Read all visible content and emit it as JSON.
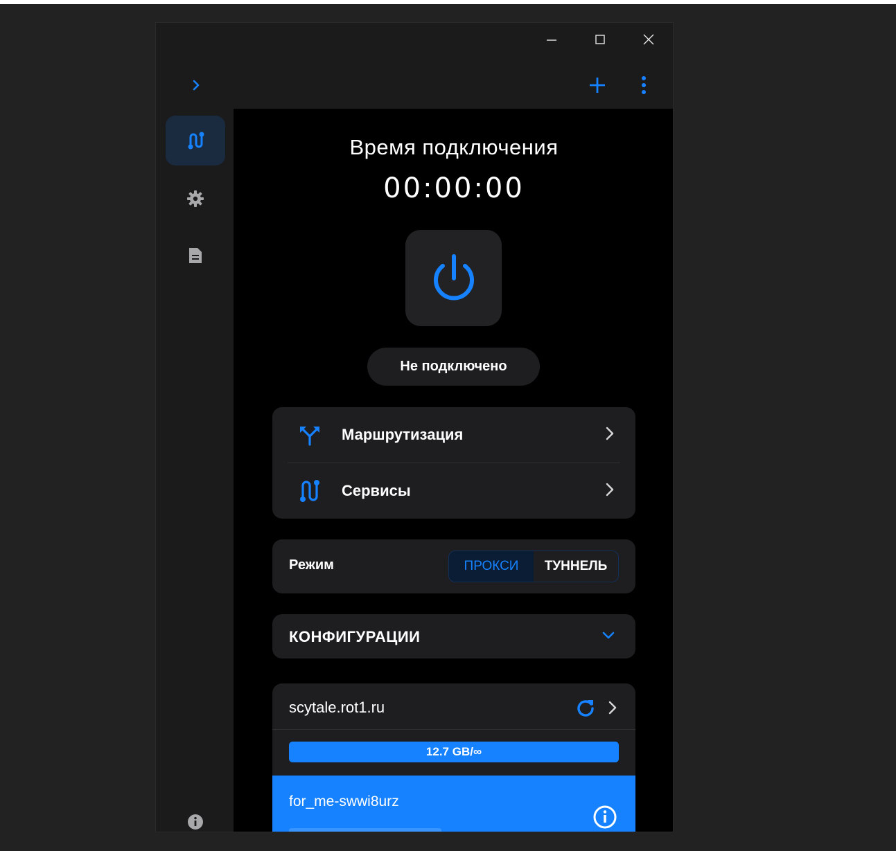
{
  "window": {
    "controls": {
      "minimize": "minimize-icon",
      "maximize": "maximize-icon",
      "close": "close-icon"
    }
  },
  "appbar": {
    "expand_icon": "chevron-right-icon",
    "add_icon": "plus-icon",
    "more_icon": "more-vertical-icon"
  },
  "rail": {
    "items": [
      {
        "icon": "routes-icon",
        "active": true
      },
      {
        "icon": "gear-icon",
        "active": false
      },
      {
        "icon": "document-icon",
        "active": false
      }
    ],
    "bottom_icon": "info-icon"
  },
  "connection": {
    "title": "Время подключения",
    "time": "00:00:00",
    "power_icon": "power-icon",
    "status": "Не подключено"
  },
  "routing": {
    "items": [
      {
        "label": "Маршрутизация",
        "icon": "split-route-icon"
      },
      {
        "label": "Сервисы",
        "icon": "services-icon"
      }
    ]
  },
  "mode": {
    "label": "Режим",
    "options": [
      "ПРОКСИ",
      "ТУННЕЛЬ"
    ],
    "selected": "ПРОКСИ"
  },
  "configs": {
    "label": "КОНФИГУРАЦИИ",
    "icon": "chevron-down-icon"
  },
  "server": {
    "name": "scytale.rot1.ru",
    "usage": "12.7 GB/∞",
    "profile": {
      "name": "for_me-swwi8urz"
    }
  },
  "colors": {
    "accent": "#1682ff",
    "background": "#000000",
    "card": "#1e1e20",
    "rail": "#1b1b1c"
  }
}
